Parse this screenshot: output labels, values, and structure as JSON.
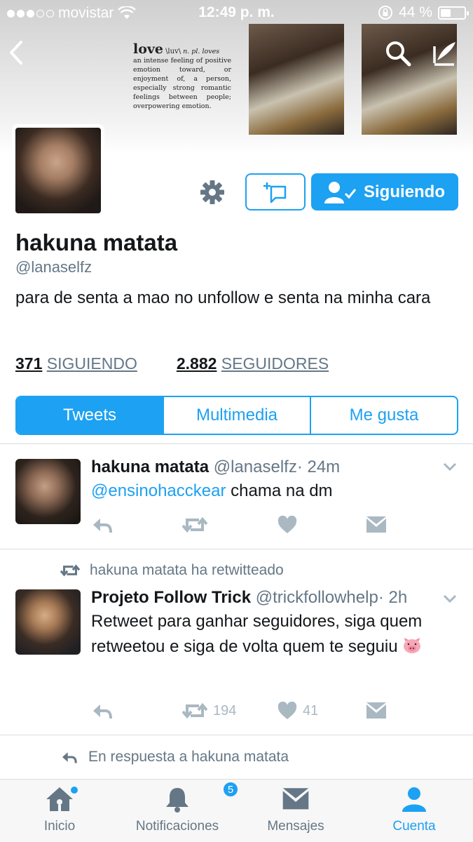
{
  "status_bar": {
    "carrier": "movistar",
    "time": "12:49 p. m.",
    "battery": "44 %",
    "battery_level": 0.44
  },
  "header": {
    "banner_text": {
      "word": "love",
      "pronunciation": "\\luv\\",
      "pos": "n. pl. loves",
      "definition": "an intense feeling of positive emotion toward, or enjoyment of, a person, especially strong romantic feelings between people; overpowering emotion."
    }
  },
  "profile": {
    "name": "hakuna matata",
    "handle": "@lanaselfz",
    "bio": "para de senta a mao no unfollow e senta na minha cara",
    "following_button": "Siguiendo",
    "stats": {
      "following_count": "371",
      "following_label": "SIGUIENDO",
      "followers_count": "2.882",
      "followers_label": "SEGUIDORES"
    }
  },
  "tabs": [
    "Tweets",
    "Multimedia",
    "Me gusta"
  ],
  "tweets": [
    {
      "name": "hakuna matata",
      "handle": "@lanaselfz",
      "time": "· 24m",
      "mention": "@ensinohacckear",
      "text": " chama na dm"
    },
    {
      "retweet_context": "hakuna matata ha retwitteado",
      "name": "Projeto Follow Trick",
      "handle": "@trickfollowhelp",
      "time": "· 2h",
      "text": "Retweet para ganhar seguidores, siga quem retweetou e siga de volta quem te seguiu",
      "retweets": "194",
      "likes": "41"
    },
    {
      "reply_context": "En respuesta a hakuna matata"
    }
  ],
  "tabbar": {
    "items": [
      {
        "label": "Inicio",
        "icon": "home-icon"
      },
      {
        "label": "Notificaciones",
        "icon": "bell-icon",
        "badge": "5"
      },
      {
        "label": "Mensajes",
        "icon": "envelope-icon"
      },
      {
        "label": "Cuenta",
        "icon": "person-icon"
      }
    ]
  },
  "colors": {
    "accent": "#1da1f2",
    "muted": "#657786",
    "icon_grey": "#aab8c2"
  }
}
